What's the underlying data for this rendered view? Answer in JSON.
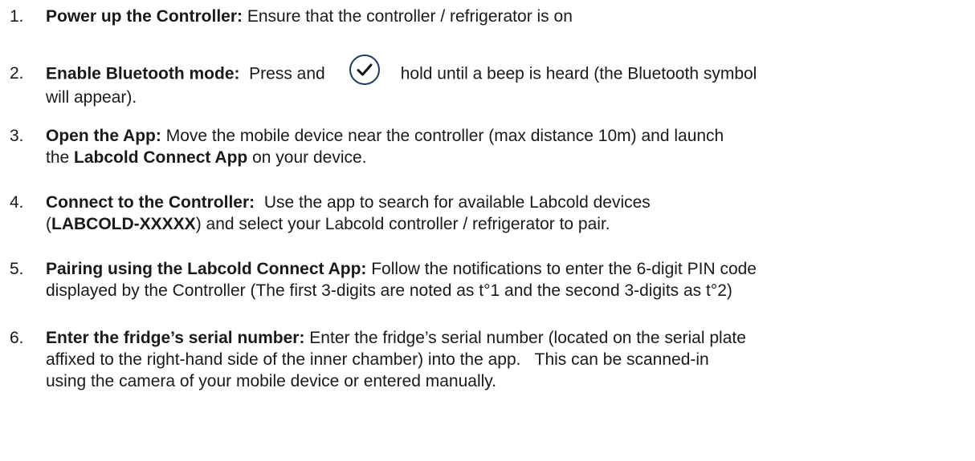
{
  "steps": [
    {
      "num": "1.",
      "title": "Power up the Controller:",
      "body": " Ensure that the controller / refrigerator is on"
    },
    {
      "num": "2.",
      "title": "Enable Bluetooth mode:",
      "before_icon": "  Press and",
      "icon": "checkmark-circle-icon",
      "after_icon": "hold until a beep is heard (the Bluetooth symbol",
      "line2": "will appear)."
    },
    {
      "num": "3.",
      "title": "Open the App:",
      "body1": " Move the mobile device near the controller (max distance 10m) and launch",
      "body2_pre": "the ",
      "app_name": "Labcold Connect App",
      "body2_post": " on your device."
    },
    {
      "num": "4.",
      "title": "Connect to the Controller:",
      "body1": "  Use the app to search for available Labcold devices",
      "paren_open": "(",
      "device_id": "LABCOLD-XXXXX",
      "body2_post": ") and select your Labcold controller / refrigerator to pair."
    },
    {
      "num": "5.",
      "title": "Pairing using the Labcold Connect App:",
      "body1": " Follow the notifications to enter the 6-digit PIN code",
      "body2": "displayed by the Controller (The first 3-digits are noted as t°1 and the second 3-digits as t°2)"
    },
    {
      "num": "6.",
      "title": "Enter the fridge’s serial number:",
      "body1": " Enter the fridge’s serial number (located on the serial plate",
      "body2": "affixed to the right-hand side of the inner chamber) into the app.   This can be scanned-in",
      "body3": "using the camera of your mobile device or entered manually."
    }
  ]
}
